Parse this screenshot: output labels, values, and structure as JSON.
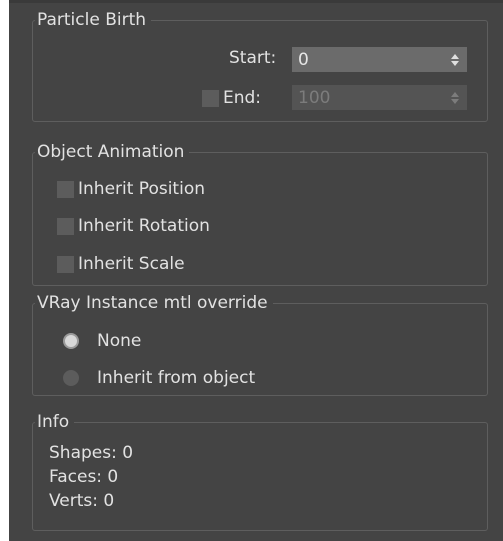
{
  "particle_birth": {
    "title": "Particle Birth",
    "start_label": "Start:",
    "start_value": "0",
    "end_label": "End:",
    "end_value": "100",
    "end_checked": false
  },
  "object_animation": {
    "title": "Object Animation",
    "options": [
      {
        "label": "Inherit Position",
        "checked": false
      },
      {
        "label": "Inherit Rotation",
        "checked": false
      },
      {
        "label": "Inherit Scale",
        "checked": false
      }
    ]
  },
  "mtl_override": {
    "title": "VRay Instance mtl override",
    "options": [
      {
        "label": "None",
        "selected": true
      },
      {
        "label": "Inherit from object",
        "selected": false
      }
    ]
  },
  "info": {
    "title": "Info",
    "shapes": "Shapes: 0",
    "faces": "Faces: 0",
    "verts": "Verts: 0"
  },
  "colors": {
    "panel_bg": "#444444",
    "field_bg": "#6b6b6b",
    "text": "#e2e2e2",
    "disabled_text": "#7c7c7c"
  }
}
